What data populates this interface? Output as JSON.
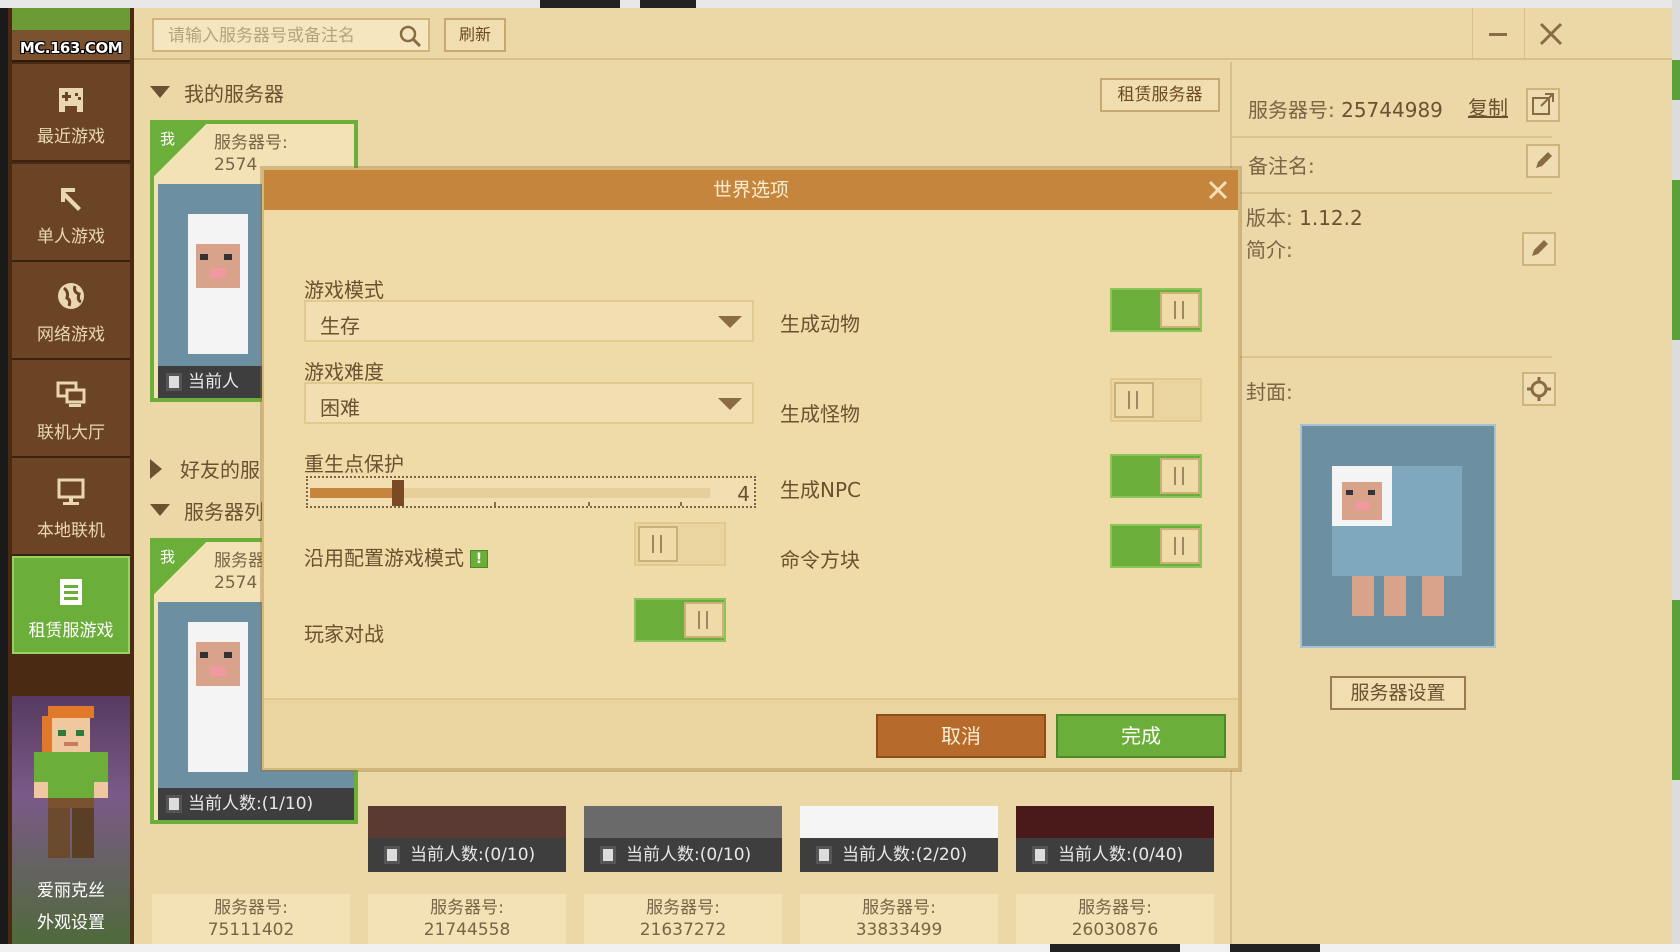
{
  "app": {
    "logo_text": "MC.163.COM"
  },
  "sidebar": {
    "items": [
      {
        "label": "最近游戏",
        "icon": "gamepad-icon"
      },
      {
        "label": "单人游戏",
        "icon": "pickaxe-icon"
      },
      {
        "label": "网络游戏",
        "icon": "globe-icon"
      },
      {
        "label": "联机大厅",
        "icon": "lobby-icon"
      },
      {
        "label": "本地联机",
        "icon": "monitor-icon"
      },
      {
        "label": "租赁服游戏",
        "icon": "document-icon",
        "active": true
      }
    ],
    "skin": {
      "name": "爱丽克丝",
      "link": "外观设置"
    }
  },
  "topbar": {
    "search_placeholder": "请输入服务器号或备注名",
    "refresh_label": "刷新"
  },
  "list": {
    "my_servers": "我的服务器",
    "friends_servers": "好友的服",
    "server_list": "服务器列",
    "rent_button": "租赁服务器",
    "top_card": {
      "me": "我",
      "id_label": "服务器号:",
      "id_partial": "2574",
      "count": "当前人"
    },
    "second_card": {
      "me": "我",
      "id_label": "服务器",
      "id_partial": "2574",
      "count": "当前人数:(1/10)"
    },
    "bottom_cards": [
      {
        "count": "当前人数:(0/10)",
        "id_label": "服务器号:",
        "id": "21744558"
      },
      {
        "count": "当前人数:(0/10)",
        "id_label": "服务器号:",
        "id": "21637272"
      },
      {
        "count": "当前人数:(2/20)",
        "id_label": "服务器号:",
        "id": "33833499"
      },
      {
        "count": "当前人数:(0/40)",
        "id_label": "服务器号:",
        "id": "26030876"
      }
    ],
    "first_id_card": {
      "id_label": "服务器号:",
      "id": "75111402"
    }
  },
  "right_panel": {
    "server_no_label": "服务器号:",
    "server_no": "25744989",
    "copy_label": "复制",
    "note_label": "备注名:",
    "version_label": "版本:",
    "version": "1.12.2",
    "intro_label": "简介:",
    "cover_label": "封面:",
    "settings_button": "服务器设置"
  },
  "modal": {
    "title": "世界选项",
    "game_mode_label": "游戏模式",
    "game_mode_value": "生存",
    "difficulty_label": "游戏难度",
    "difficulty_value": "困难",
    "spawn_protect_label": "重生点保护",
    "spawn_protect_value": "4",
    "spawn_protect_fraction": 0.22,
    "use_config_mode_label": "沿用配置游戏模式",
    "use_config_mode_on": false,
    "pvp_label": "玩家对战",
    "pvp_on": true,
    "spawn_animals_label": "生成动物",
    "spawn_animals_on": true,
    "spawn_monsters_label": "生成怪物",
    "spawn_monsters_on": false,
    "spawn_npc_label": "生成NPC",
    "spawn_npc_on": true,
    "command_block_label": "命令方块",
    "command_block_on": true,
    "cancel_label": "取消",
    "done_label": "完成"
  },
  "colors": {
    "accent_green": "#6cae3a",
    "header_orange": "#c6853c",
    "cancel_brown": "#b66a2c",
    "panel_tan": "#ecd7a6"
  }
}
